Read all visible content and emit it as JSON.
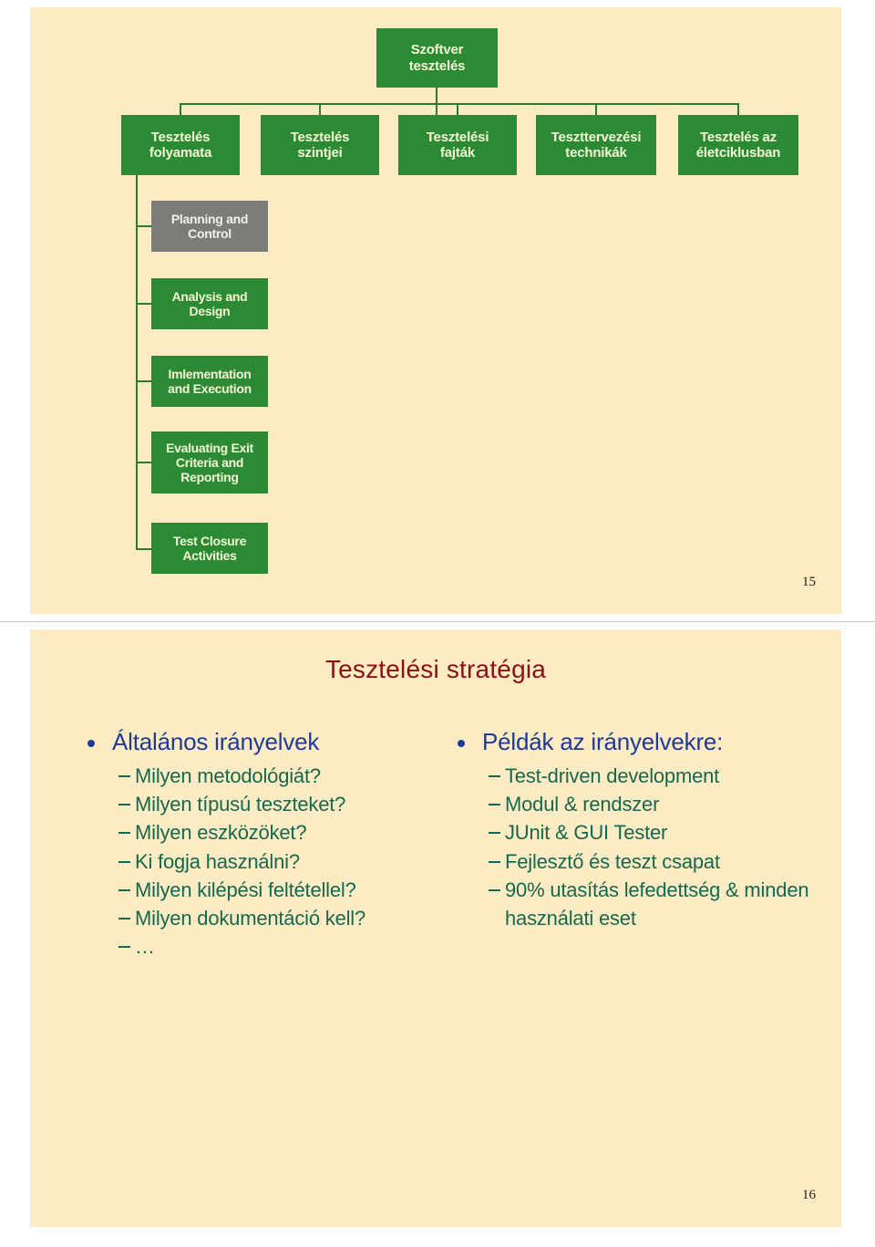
{
  "slide_1": {
    "number": "15",
    "diagram": {
      "root": {
        "label": "Szoftver\ntesztelés"
      },
      "branches": [
        {
          "label": "Tesztelés\nfolyamata"
        },
        {
          "label": "Tesztelés\nszintjei"
        },
        {
          "label": "Tesztelési\nfajták"
        },
        {
          "label": "Teszttervezési\ntechnikák"
        },
        {
          "label": "Tesztelés az\néletciklusban"
        }
      ],
      "process_steps": [
        {
          "label": "Planning and\nControl",
          "state": "highlighted"
        },
        {
          "label": "Analysis and\nDesign",
          "state": "normal"
        },
        {
          "label": "Imlementation\nand Execution",
          "state": "normal"
        },
        {
          "label": "Evaluating Exit\nCriteria and\nReporting",
          "state": "normal"
        },
        {
          "label": "Test Closure\nActivities",
          "state": "normal"
        }
      ],
      "colors": {
        "node_green": "#2b8a33",
        "node_gray": "#7c7c79",
        "connector": "#2b7a33",
        "node_text": "#f3f7d4",
        "background": "#fdecc3"
      }
    }
  },
  "slide_2": {
    "number": "16",
    "title": "Tesztelési stratégia",
    "colors": {
      "title": "#8b1111",
      "level1": "#1f3a93",
      "level2": "#16674f",
      "background": "#fdecc3"
    },
    "left_column": {
      "heading": "Általános irányelvek",
      "items": [
        "Milyen metodológiát?",
        "Milyen típusú teszteket?",
        "Milyen eszközöket?",
        "Ki fogja használni?",
        "Milyen kilépési feltétellel?",
        "Milyen dokumentáció kell?",
        "…"
      ]
    },
    "right_column": {
      "heading": "Példák az irányelvekre:",
      "items": [
        "Test-driven development",
        "Modul & rendszer",
        "JUnit & GUI Tester",
        "Fejlesztő és teszt csapat",
        "90% utasítás lefedettség & minden használati eset"
      ]
    }
  }
}
